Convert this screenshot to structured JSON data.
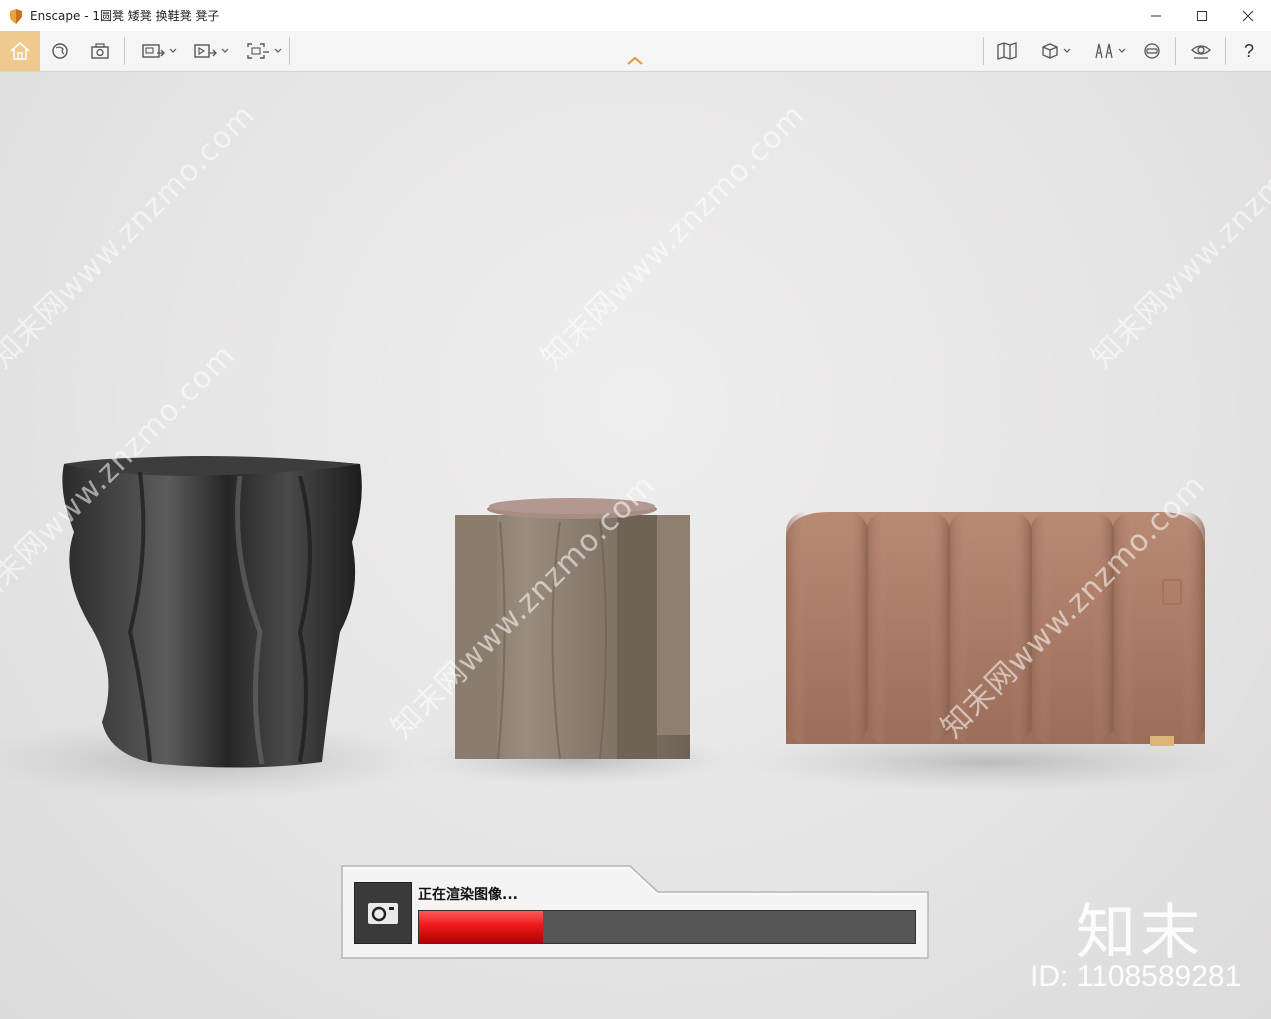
{
  "window": {
    "title": "Enscape - 1圆凳 矮凳 换鞋凳 凳子",
    "controls": [
      "minimize-icon",
      "maximize-icon",
      "close-icon"
    ]
  },
  "toolbar": {
    "left": [
      "home-icon",
      "asset-library-icon",
      "capture-icon",
      "views-icon",
      "video-editor-icon",
      "screenshot-icon"
    ],
    "right": [
      "map-icon",
      "cube-view-icon",
      "panorama-icon",
      "vr-icon",
      "visual-settings-icon"
    ],
    "help_label": "?",
    "accent": "#f0c98f"
  },
  "watermark": {
    "text": "知末网www.znzmo.com",
    "brand": "知末",
    "id": "ID: 1108589281"
  },
  "render_dialog": {
    "status": "正在渲染图像...",
    "progress": 0.25,
    "progress_color": "#ee1a1a"
  }
}
